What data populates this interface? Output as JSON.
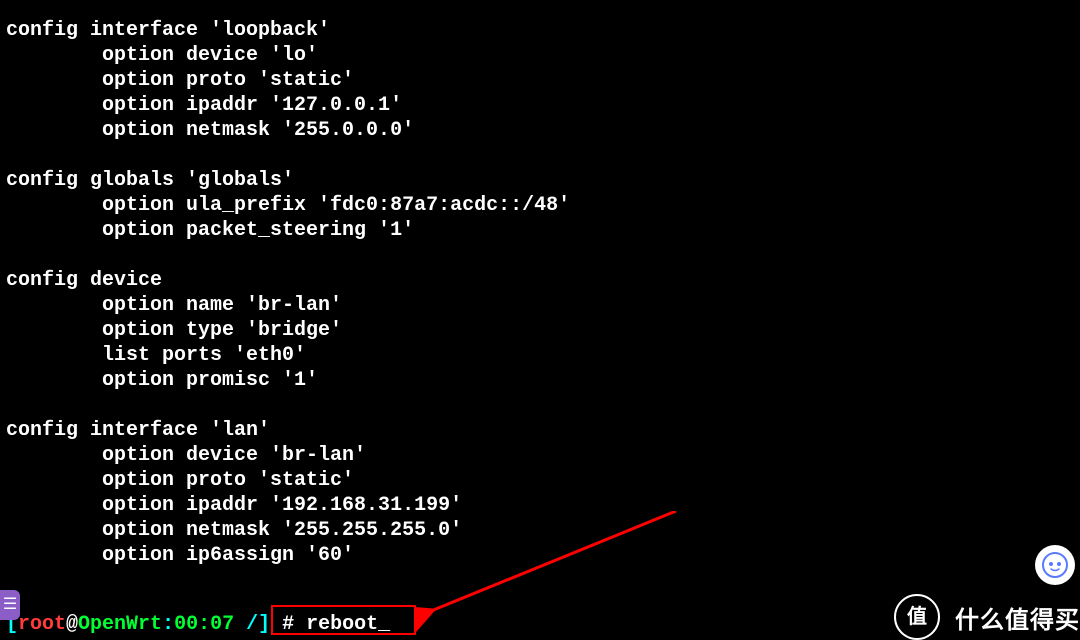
{
  "config_text": "config interface 'loopback'\n        option device 'lo'\n        option proto 'static'\n        option ipaddr '127.0.0.1'\n        option netmask '255.0.0.0'\n\nconfig globals 'globals'\n        option ula_prefix 'fdc0:87a7:acdc::/48'\n        option packet_steering '1'\n\nconfig device\n        option name 'br-lan'\n        option type 'bridge'\n        list ports 'eth0'\n        option promisc '1'\n\nconfig interface 'lan'\n        option device 'br-lan'\n        option proto 'static'\n        option ipaddr '192.168.31.199'\n        option netmask '255.255.255.0'\n        option ip6assign '60'",
  "prompt": {
    "bracket_open": "[",
    "user": "root",
    "at": "@",
    "host": "OpenWrt",
    "colon": ":",
    "time": "00:07",
    "path": " /",
    "bracket_close": "]",
    "hash": " # ",
    "command": "reboot"
  },
  "sidebar_glyph": "☰",
  "watermark_badge": "值",
  "watermark_text": "什么值得买"
}
